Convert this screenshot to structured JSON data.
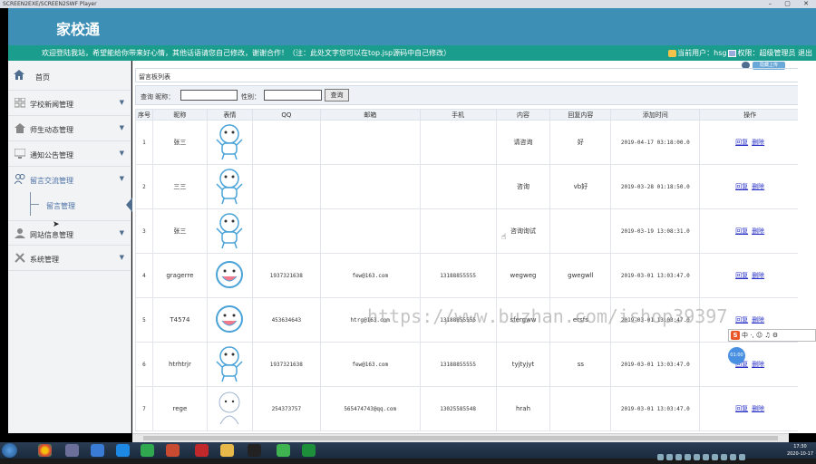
{
  "window": {
    "title": "SCREEN2EXE/SCREEN2SWF Player"
  },
  "header": {
    "brand": "家校通",
    "marquee": "欢迎登陆我站，希望能给你带来好心情，其他话语请您自己修改，谢谢合作！（注：此处文字您可以在top.jsp源码中自己修改）",
    "user_info": "当前用户：hsg",
    "role_info": "权限：超级管理员 退出",
    "hud_button": "隐藏上传"
  },
  "sidebar": {
    "home": "首页",
    "items": [
      {
        "label": "学校新闻管理",
        "icon": "grid-icon"
      },
      {
        "label": "师生动态管理",
        "icon": "home-icon"
      },
      {
        "label": "通知公告管理",
        "icon": "monitor-icon"
      },
      {
        "label": "留言交流管理",
        "icon": "people-icon"
      }
    ],
    "sub_item": "留言管理",
    "items_after": [
      {
        "label": "网站信息管理",
        "icon": "user-icon"
      },
      {
        "label": "系统管理",
        "icon": "tools-icon"
      }
    ]
  },
  "panel": {
    "title": "留言板列表",
    "search": {
      "label_nickname": "查询 昵称：",
      "label_gender": "性别：",
      "button": "查询"
    }
  },
  "table": {
    "headers": [
      "序号",
      "昵称",
      "表情",
      "QQ",
      "邮箱",
      "手机",
      "内容",
      "回复内容",
      "添加时间",
      "操作"
    ],
    "op_reply": "回复",
    "op_delete": "删除",
    "rows": [
      {
        "no": "1",
        "nick": "张三",
        "qq": "",
        "email": "",
        "phone": "",
        "content": "请咨询",
        "reply": "好",
        "time": "2019-04-17 03:18:00.0"
      },
      {
        "no": "2",
        "nick": "三三",
        "qq": "",
        "email": "",
        "phone": "",
        "content": "咨询",
        "reply": "vb好",
        "time": "2019-03-28 01:18:50.0"
      },
      {
        "no": "3",
        "nick": "张三",
        "qq": "",
        "email": "",
        "phone": "",
        "content": "咨询询试",
        "reply": "",
        "time": "2019-03-19 13:08:31.0"
      },
      {
        "no": "4",
        "nick": "gragerre",
        "qq": "1937321638",
        "email": "few@163.com",
        "phone": "13188855555",
        "content": "wegweg",
        "reply": "gwegwll",
        "time": "2019-03-01 13:03:47.0"
      },
      {
        "no": "5",
        "nick": "T4574",
        "qq": "453634643",
        "email": "htrg@163.com",
        "phone": "13188855555",
        "content": "sfergww",
        "reply": "ersfs",
        "time": "2019-03-01 13:03:47.0"
      },
      {
        "no": "6",
        "nick": "htrhtrjr",
        "qq": "1937321638",
        "email": "few@163.com",
        "phone": "13188855555",
        "content": "tyjtyjyt",
        "reply": "ss",
        "time": "2019-03-01 13:03:47.0"
      },
      {
        "no": "7",
        "nick": "rege",
        "qq": "254373757",
        "email": "565474743@qq.com",
        "phone": "13025585548",
        "content": "hrah",
        "reply": "",
        "time": "2019-03-01 13:03:47.0"
      }
    ]
  },
  "watermark": "https://www.buzhan.com/ishop39397",
  "ime": {
    "label": "中 ·, ☺ ♫ ⚙"
  },
  "bubble": "01:00",
  "tray": {
    "time": "17:30",
    "date": "2020-10-17"
  },
  "colors": {
    "banner": "#3d8fb5",
    "greenbar": "#1a9d8c",
    "link": "#2a32c6"
  }
}
